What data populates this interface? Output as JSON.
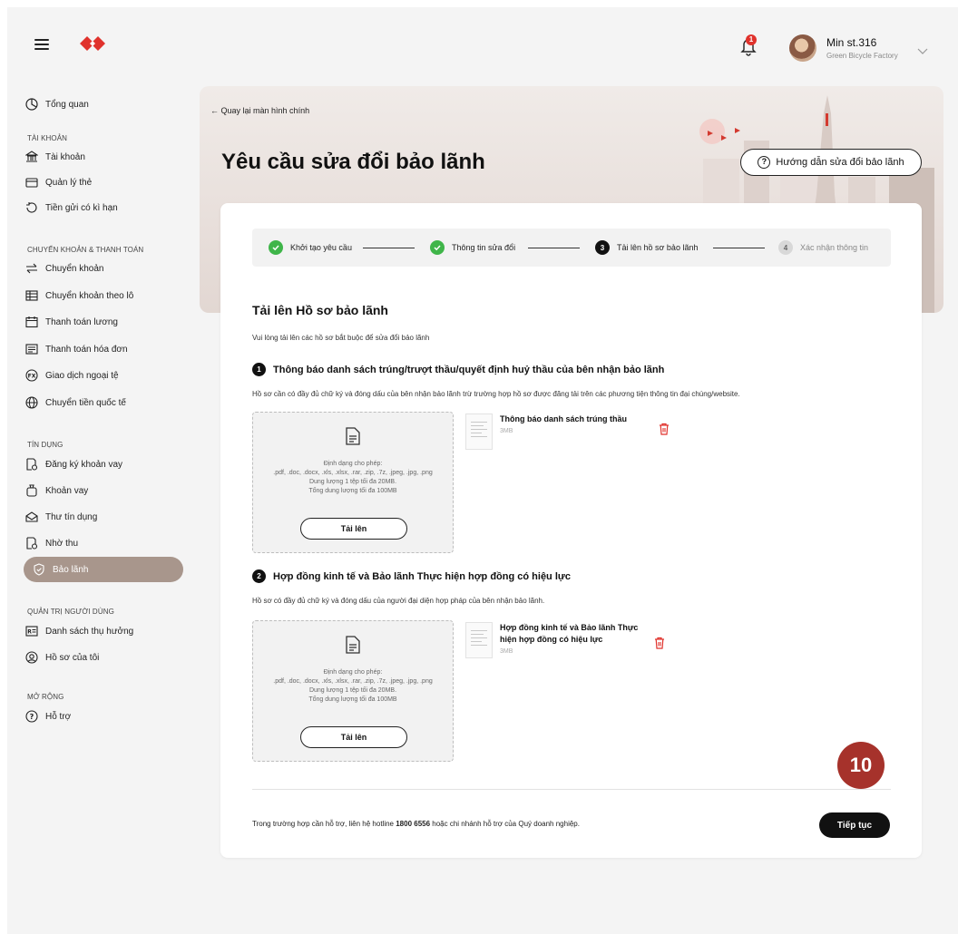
{
  "header": {
    "user_name": "Min st.316",
    "company": "Green Bicycle Factory",
    "notification_count": "1"
  },
  "sidebar": {
    "overview": "Tổng quan",
    "sections": [
      "TÀI KHOẢN",
      "CHUYỂN KHOẢN & THANH TOÁN",
      "TÍN DỤNG",
      "QUẢN TRỊ NGƯỜI DÙNG",
      "MỞ RỘNG"
    ],
    "account_items": [
      "Tài khoản",
      "Quản lý thẻ",
      "Tiền gửi có kì hạn"
    ],
    "transfer_items": [
      "Chuyển khoản",
      "Chuyển khoản theo lô",
      "Thanh toán lương",
      "Thanh toán hóa đơn",
      "Giao dịch ngoại tệ",
      "Chuyển tiền quốc tế"
    ],
    "credit_items": [
      "Đăng ký khoản vay",
      "Khoản vay",
      "Thư tín dụng",
      "Nhờ thu",
      "Bảo lãnh"
    ],
    "admin_items": [
      "Danh sách thụ hưởng",
      "Hồ sơ của tôi"
    ],
    "extend_items": [
      "Hỗ trợ"
    ]
  },
  "hero": {
    "back_label": "Quay lại màn hình chính",
    "title": "Yêu cầu sửa đổi bảo lãnh",
    "guide_label": "Hướng dẫn sửa đổi bảo lãnh"
  },
  "stepper": {
    "steps": [
      {
        "label": "Khởi tạo yêu cầu",
        "state": "done"
      },
      {
        "label": "Thông tin sửa đổi",
        "state": "done"
      },
      {
        "label": "Tải lên hồ sơ bảo lãnh",
        "state": "active",
        "num": "3"
      },
      {
        "label": "Xác nhận thông tin",
        "state": "todo",
        "num": "4"
      }
    ]
  },
  "main": {
    "title": "Tải lên Hồ sơ bảo lãnh",
    "subtitle": "Vui lòng tải lên các hồ sơ bắt buộc để sửa đổi bảo lãnh",
    "items": [
      {
        "num": "1",
        "title": "Thông báo danh sách trúng/trượt thầu/quyết định huỷ thầu của bên nhận bảo lãnh",
        "desc": "Hồ sơ cần có đầy đủ chữ ký và đóng dấu của bên nhận bảo lãnh trừ trường hợp hồ sơ được đăng tải trên các phương tiện thông tin đại chúng/website.",
        "file_name": "Thông báo danh sách trúng thầu",
        "file_size": "3MB"
      },
      {
        "num": "2",
        "title": "Hợp đồng kinh tế và Bảo lãnh Thực hiện hợp đồng có hiệu lực",
        "desc": "Hồ sơ có đầy đủ chữ ký và đóng dấu của người đại diện hợp pháp của bên nhận bảo lãnh.",
        "file_name_line1": "Hợp đồng kinh tế và Bảo lãnh Thực",
        "file_name_line2": "hiện hợp đồng có hiệu lực",
        "file_size": "3MB"
      }
    ],
    "dropzone": {
      "formats_label": "Định dạng cho phép:",
      "formats": ".pdf, .doc, .docx, .xls, .xlsx, .rar, .zip, .7z, .jpeg, .jpg, .png",
      "size_limit": "Dung lượng 1 tệp tối đa 20MB.",
      "total_limit": "Tổng dung lượng tối đa 100MB",
      "upload_label": "Tải lên"
    },
    "footer_before": "Trong trường hợp cần hỗ trợ, liên hệ hotline ",
    "hotline": "1800 6556",
    "footer_after": " hoặc chi nhánh hỗ trợ của Quý doanh nghiệp.",
    "next_label": "Tiếp tục"
  },
  "overlay_badge": "10",
  "colors": {
    "brand": "#e0322c",
    "active_nav": "#a8968c",
    "success": "#3fb549",
    "badge": "#a6322b"
  }
}
